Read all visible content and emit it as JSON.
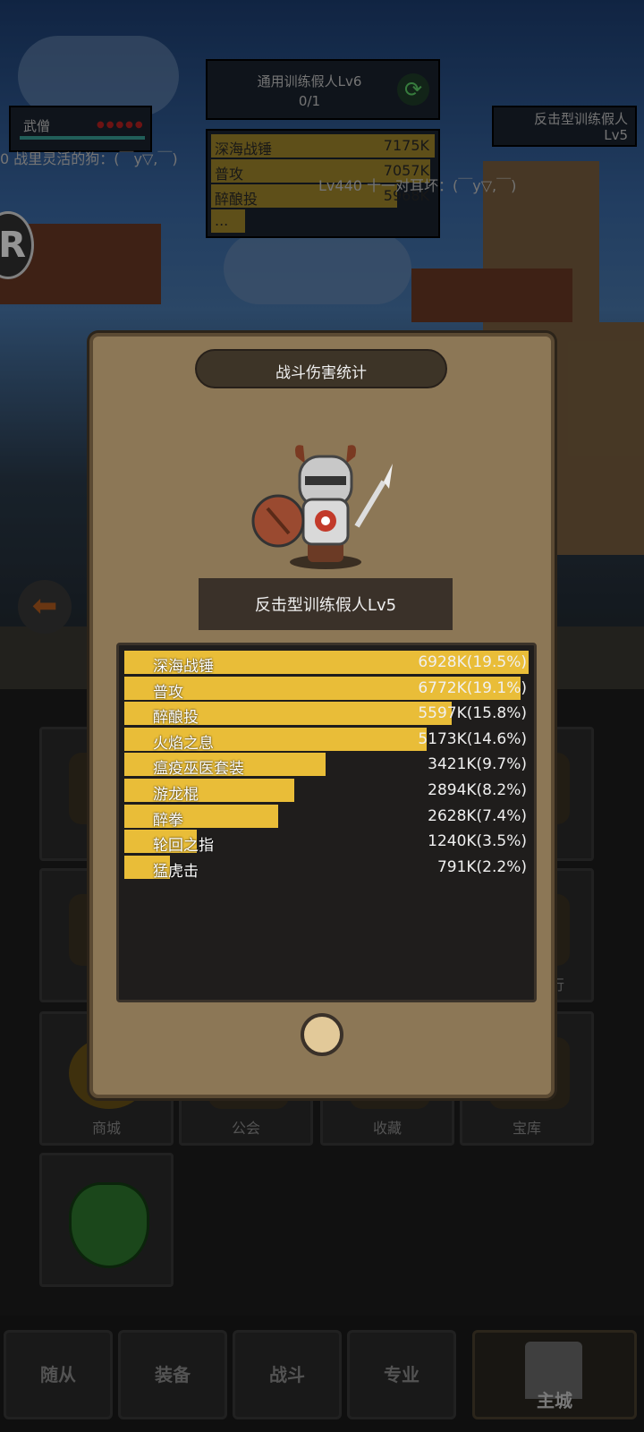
{
  "hud": {
    "task_title": "通用训练假人Lv6",
    "task_progress": "0/1",
    "player": {
      "name": "武僧"
    },
    "enemy": {
      "name": "反击型训练假人",
      "level": "Lv5"
    },
    "chat1": "0 战里灵活的狗：(￣y▽,￣)",
    "chat2": "Lv440 十一对耳坏：(￣y▽,￣)",
    "mini_damage": [
      {
        "name": "深海战锤",
        "value": "7175K",
        "fill": 1.0
      },
      {
        "name": "普攻",
        "value": "7057K",
        "fill": 0.98
      },
      {
        "name": "醉酿投",
        "value": "5968K",
        "fill": 0.83
      },
      {
        "name": "...",
        "value": "",
        "fill": 0.15
      }
    ],
    "r_badge": "R"
  },
  "modal": {
    "title": "战斗伤害统计",
    "monster_name": "反击型训练假人Lv5",
    "stats": [
      {
        "name": "深海战锤",
        "value": "6928K(19.5%)",
        "pct": 19.5
      },
      {
        "name": "普攻",
        "value": "6772K(19.1%)",
        "pct": 19.1
      },
      {
        "name": "醉酿投",
        "value": "5597K(15.8%)",
        "pct": 15.8
      },
      {
        "name": "火焰之息",
        "value": "5173K(14.6%)",
        "pct": 14.6
      },
      {
        "name": "瘟疫巫医套装",
        "value": "3421K(9.7%)",
        "pct": 9.7
      },
      {
        "name": "游龙棍",
        "value": "2894K(8.2%)",
        "pct": 8.2
      },
      {
        "name": "醉拳",
        "value": "2628K(7.4%)",
        "pct": 7.4
      },
      {
        "name": "轮回之指",
        "value": "1240K(3.5%)",
        "pct": 3.5
      },
      {
        "name": "猛虎击",
        "value": "791K(2.2%)",
        "pct": 2.2
      }
    ]
  },
  "tiles": {
    "shop": "商城",
    "guild": "公会",
    "collection": "收藏",
    "treasury": "宝库",
    "row2_right_partial": "行"
  },
  "nav": {
    "followers": "随从",
    "equipment": "装备",
    "battle": "战斗",
    "profession": "专业",
    "main_city": "主城"
  },
  "colors": {
    "bar": "#e9bd38",
    "modal_bg": "#8c7756",
    "panel_bg": "#1f1d1c"
  }
}
